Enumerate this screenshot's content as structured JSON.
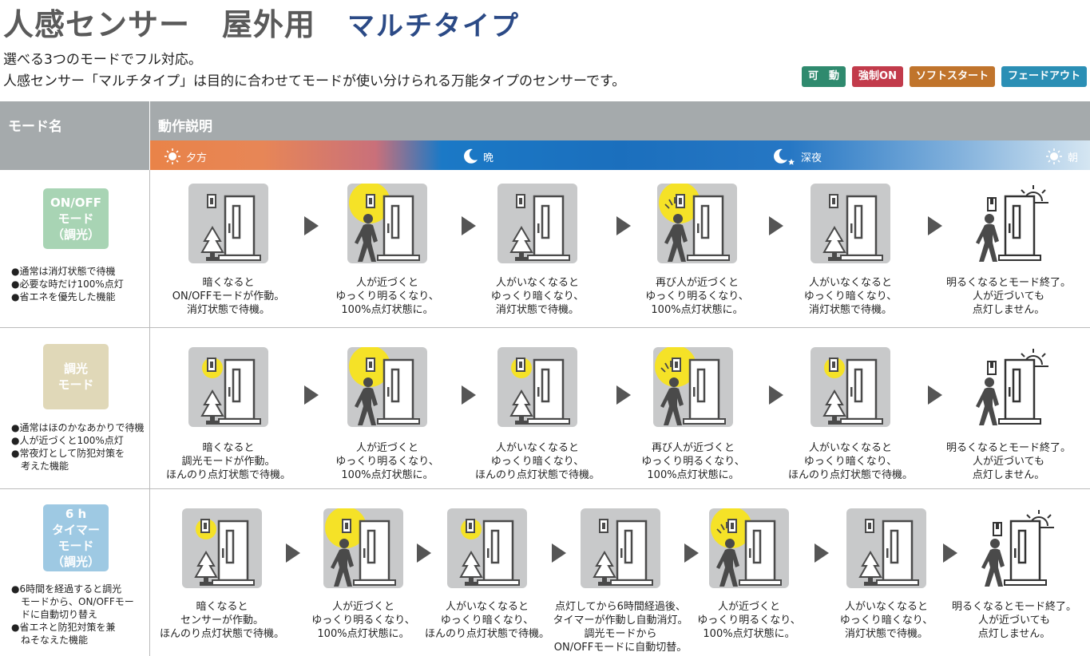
{
  "title": {
    "main": "人感センサー",
    "sub": "屋外用",
    "type": "マルチタイプ"
  },
  "subtitle_1": "選べる3つのモードでフル対応。",
  "subtitle_2": "人感センサー「マルチタイプ」は目的に合わせてモードが使い分けられる万能タイプのセンサーです。",
  "badges": [
    {
      "label": "可　動",
      "color": "#2f8a6e"
    },
    {
      "label": "強制ON",
      "color": "#c23b4b"
    },
    {
      "label": "ソフトスタート",
      "color": "#c0742c"
    },
    {
      "label": "フェードアウト",
      "color": "#2b8fb5"
    }
  ],
  "header": {
    "mode_label": "モード名",
    "desc_label": "動作説明"
  },
  "timeline": {
    "evening": "夕方",
    "night": "晩",
    "late_night": "深夜",
    "morning": "朝"
  },
  "colors": {
    "header_gray": "#a5aaac",
    "tile_gray": "#c8c9ca",
    "light_yellow": "#f5e227",
    "onoff_green": "#a8d4b4",
    "dim_beige": "#e0d8b8",
    "timer_blue": "#9ec9e3"
  },
  "modes": [
    {
      "name_lines": [
        "ON/OFF",
        "モード",
        "（調光）"
      ],
      "color": "#a8d4b4",
      "notes": [
        "●通常は消灯状態で待機",
        "●必要な時だけ100%点灯",
        "●省エネを優先した機能"
      ],
      "steps": [
        {
          "scene": "dark",
          "caption": [
            "暗くなると",
            "ON/OFFモードが作動。",
            "消灯状態で待機。"
          ]
        },
        {
          "scene": "person_bright",
          "caption": [
            "人が近づくと",
            "ゆっくり明るくなり、",
            "100%点灯状態に。"
          ]
        },
        {
          "scene": "dark",
          "caption": [
            "人がいなくなると",
            "ゆっくり暗くなり、",
            "消灯状態で待機。"
          ]
        },
        {
          "scene": "person_bright_again",
          "caption": [
            "再び人が近づくと",
            "ゆっくり明るくなり、",
            "100%点灯状態に。"
          ]
        },
        {
          "scene": "dark",
          "caption": [
            "人がいなくなると",
            "ゆっくり暗くなり、",
            "消灯状態で待機。"
          ]
        },
        {
          "scene": "morning",
          "caption": [
            "明るくなるとモード終了。",
            "人が近づいても",
            "点灯しません。"
          ]
        }
      ]
    },
    {
      "name_lines": [
        "調光",
        "モード"
      ],
      "color": "#e0d8b8",
      "notes": [
        "●通常はほのかなあかりで待機",
        "●人が近づくと100%点灯",
        "●常夜灯として防犯対策を",
        "　考えた機能"
      ],
      "steps": [
        {
          "scene": "dim",
          "caption": [
            "暗くなると",
            "調光モードが作動。",
            "ほんのり点灯状態で待機。"
          ]
        },
        {
          "scene": "person_bright",
          "caption": [
            "人が近づくと",
            "ゆっくり明るくなり、",
            "100%点灯状態に。"
          ]
        },
        {
          "scene": "dim",
          "caption": [
            "人がいなくなると",
            "ゆっくり暗くなり、",
            "ほんのり点灯状態で待機。"
          ]
        },
        {
          "scene": "person_bright_again",
          "caption": [
            "再び人が近づくと",
            "ゆっくり明るくなり、",
            "100%点灯状態に。"
          ]
        },
        {
          "scene": "dim",
          "caption": [
            "人がいなくなると",
            "ゆっくり暗くなり、",
            "ほんのり点灯状態で待機。"
          ]
        },
        {
          "scene": "morning",
          "caption": [
            "明るくなるとモード終了。",
            "人が近づいても",
            "点灯しません。"
          ]
        }
      ]
    },
    {
      "name_lines": [
        "6 h",
        "タイマー",
        "モード",
        "（調光）"
      ],
      "color": "#9ec9e3",
      "notes": [
        "●6時間を経過すると調光",
        "　モードから、ON/OFFモー",
        "　ドに自動切り替え",
        "●省エネと防犯対策を兼",
        "　ねそなえた機能"
      ],
      "steps": [
        {
          "scene": "dim",
          "caption": [
            "暗くなると",
            "センサーが作動。",
            "ほんのり点灯状態で待機。"
          ]
        },
        {
          "scene": "person_bright",
          "caption": [
            "人が近づくと",
            "ゆっくり明るくなり、",
            "100%点灯状態に。"
          ]
        },
        {
          "scene": "dim",
          "caption": [
            "人がいなくなると",
            "ゆっくり暗くなり、",
            "ほんのり点灯状態で待機。"
          ]
        },
        {
          "scene": "dark",
          "caption": [
            "点灯してから6時間経過後、",
            "タイマーが作動し自動消灯。",
            "調光モードから",
            "ON/OFFモードに自動切替。"
          ]
        },
        {
          "scene": "person_bright_again",
          "caption": [
            "人が近づくと",
            "ゆっくり明るくなり、",
            "100%点灯状態に。"
          ]
        },
        {
          "scene": "dark",
          "caption": [
            "人がいなくなると",
            "ゆっくり暗くなり、",
            "消灯状態で待機。"
          ]
        },
        {
          "scene": "morning",
          "caption": [
            "明るくなるとモード終了。",
            "人が近づいても",
            "点灯しません。"
          ]
        }
      ]
    }
  ]
}
